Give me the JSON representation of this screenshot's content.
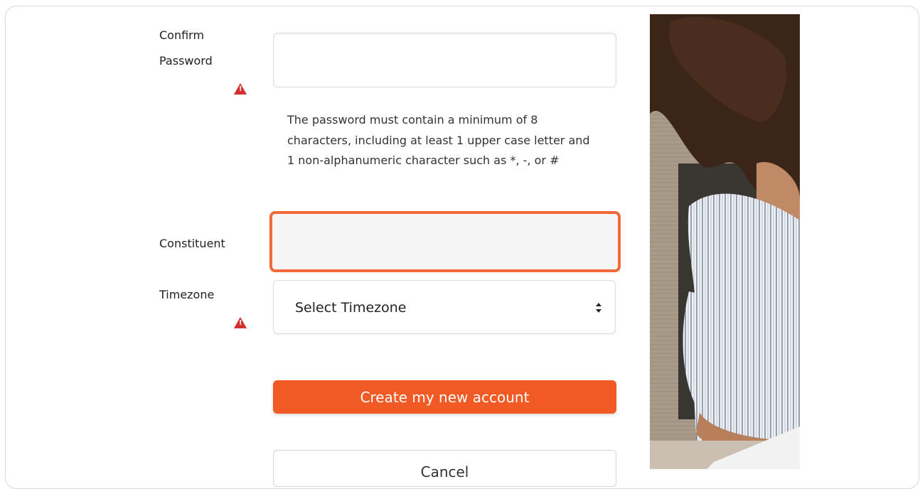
{
  "form": {
    "confirm_password": {
      "label_line1": "Confirm",
      "label_line2": "Password",
      "value": ""
    },
    "password_help": "The password must contain a minimum of 8 characters, including at least 1 upper case letter and 1 non-alphanumeric character such as *, -, or #",
    "constituent": {
      "label": "Constituent",
      "value": ""
    },
    "timezone": {
      "label": "Timezone",
      "selected": "Select Timezone"
    },
    "submit_label": "Create my new account",
    "cancel_label": "Cancel"
  },
  "colors": {
    "accent": "#f15a24",
    "focus_border": "#f26a3a",
    "warning": "#d32f2f"
  },
  "icons": {
    "warning": "warning-icon",
    "select_arrows": "sort-arrows-icon"
  }
}
